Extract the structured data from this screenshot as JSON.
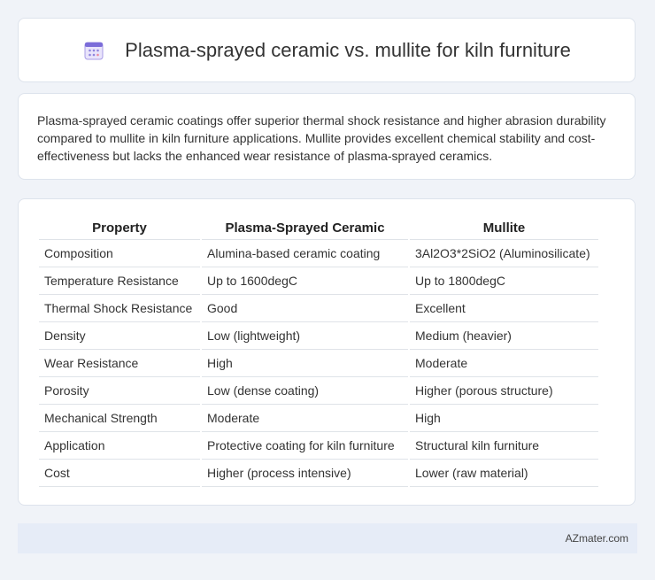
{
  "header": {
    "title": "Plasma-sprayed ceramic vs. mullite for kiln furniture",
    "icon": "calendar-grid-icon"
  },
  "summary": {
    "text": "Plasma-sprayed ceramic coatings offer superior thermal shock resistance and higher abrasion durability compared to mullite in kiln furniture applications. Mullite provides excellent chemical stability and cost-effectiveness but lacks the enhanced wear resistance of plasma-sprayed ceramics."
  },
  "table": {
    "headers": [
      "Property",
      "Plasma-Sprayed Ceramic",
      "Mullite"
    ],
    "rows": [
      [
        "Composition",
        "Alumina-based ceramic coating",
        "3Al2O3*2SiO2 (Aluminosilicate)"
      ],
      [
        "Temperature Resistance",
        "Up to 1600degC",
        "Up to 1800degC"
      ],
      [
        "Thermal Shock Resistance",
        "Good",
        "Excellent"
      ],
      [
        "Density",
        "Low (lightweight)",
        "Medium (heavier)"
      ],
      [
        "Wear Resistance",
        "High",
        "Moderate"
      ],
      [
        "Porosity",
        "Low (dense coating)",
        "Higher (porous structure)"
      ],
      [
        "Mechanical Strength",
        "Moderate",
        "High"
      ],
      [
        "Application",
        "Protective coating for kiln furniture",
        "Structural kiln furniture"
      ],
      [
        "Cost",
        "Higher (process intensive)",
        "Lower (raw material)"
      ]
    ]
  },
  "footer": {
    "brand": "AZmater.com"
  },
  "colors": {
    "background": "#f0f3f8",
    "card": "#ffffff",
    "footer": "#e6ecf7",
    "icon_accent": "#7b6cd9"
  }
}
